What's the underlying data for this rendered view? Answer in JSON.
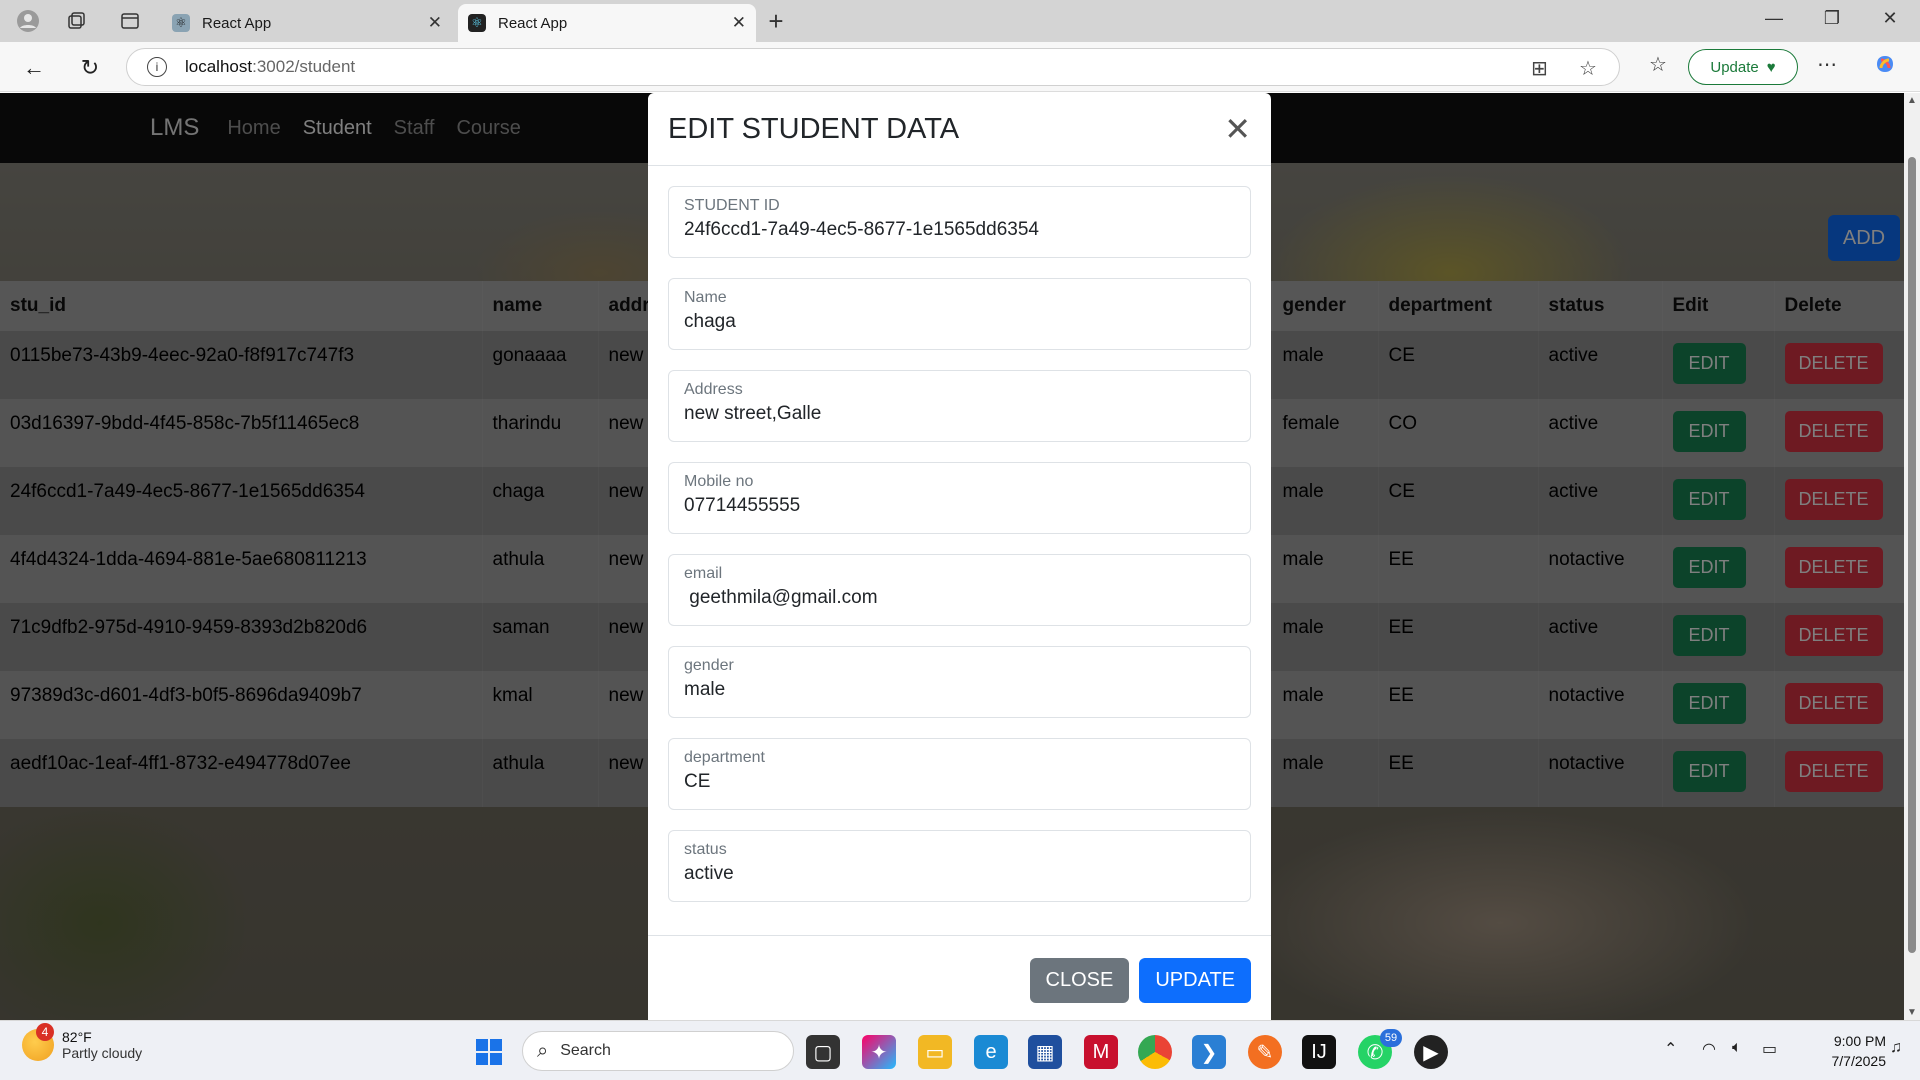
{
  "browser": {
    "tabs": [
      {
        "title": "React App",
        "active": false
      },
      {
        "title": "React App",
        "active": true
      }
    ],
    "url_host": "localhost",
    "url_path": ":3002/student",
    "update_label": "Update"
  },
  "navbar": {
    "brand": "LMS",
    "links": [
      "Home",
      "Student",
      "Staff",
      "Course"
    ],
    "active": "Student"
  },
  "add_label": "ADD",
  "table": {
    "headers": [
      "stu_id",
      "name",
      "addr",
      "gender",
      "department",
      "status",
      "Edit",
      "Delete"
    ],
    "edit_label": "EDIT",
    "delete_label": "DELETE",
    "rows": [
      {
        "stu_id": "0115be73-43b9-4eec-92a0-f8f917c747f3",
        "name": "gonaaaa",
        "address": "new",
        "gender": "male",
        "department": "CE",
        "status": "active"
      },
      {
        "stu_id": "03d16397-9bdd-4f45-858c-7b5f11465ec8",
        "name": "tharindu",
        "address": "new",
        "gender": "female",
        "department": "CO",
        "status": "active"
      },
      {
        "stu_id": "24f6ccd1-7a49-4ec5-8677-1e1565dd6354",
        "name": "chaga",
        "address": "new",
        "gender": "male",
        "department": "CE",
        "status": "active"
      },
      {
        "stu_id": "4f4d4324-1dda-4694-881e-5ae680811213",
        "name": "athula",
        "address": "new",
        "gender": "male",
        "department": "EE",
        "status": "notactive"
      },
      {
        "stu_id": "71c9dfb2-975d-4910-9459-8393d2b820d6",
        "name": "saman",
        "address": "new",
        "gender": "male",
        "department": "EE",
        "status": "active"
      },
      {
        "stu_id": "97389d3c-d601-4df3-b0f5-8696da9409b7",
        "name": "kmal",
        "address": "new",
        "gender": "male",
        "department": "EE",
        "status": "notactive"
      },
      {
        "stu_id": "aedf10ac-1eaf-4ff1-8732-e494778d07ee",
        "name": "athula",
        "address": "new",
        "gender": "male",
        "department": "EE",
        "status": "notactive"
      }
    ]
  },
  "modal": {
    "title": "EDIT STUDENT DATA",
    "fields": [
      {
        "label": "STUDENT ID",
        "value": "24f6ccd1-7a49-4ec5-8677-1e1565dd6354"
      },
      {
        "label": "Name",
        "value": "chaga"
      },
      {
        "label": "Address",
        "value": "new street,Galle"
      },
      {
        "label": "Mobile no",
        "value": "07714455555"
      },
      {
        "label": "email",
        "value": " geethmila@gmail.com"
      },
      {
        "label": "gender",
        "value": "male"
      },
      {
        "label": "department",
        "value": "CE"
      },
      {
        "label": "status",
        "value": "active"
      }
    ],
    "close_label": "CLOSE",
    "update_label": "UPDATE"
  },
  "taskbar": {
    "weather_temp": "82°F",
    "weather_desc": "Partly cloudy",
    "weather_badge": "4",
    "search_label": "Search",
    "whatsapp_badge": "59",
    "time": "9:00 PM",
    "date": "7/7/2025"
  }
}
